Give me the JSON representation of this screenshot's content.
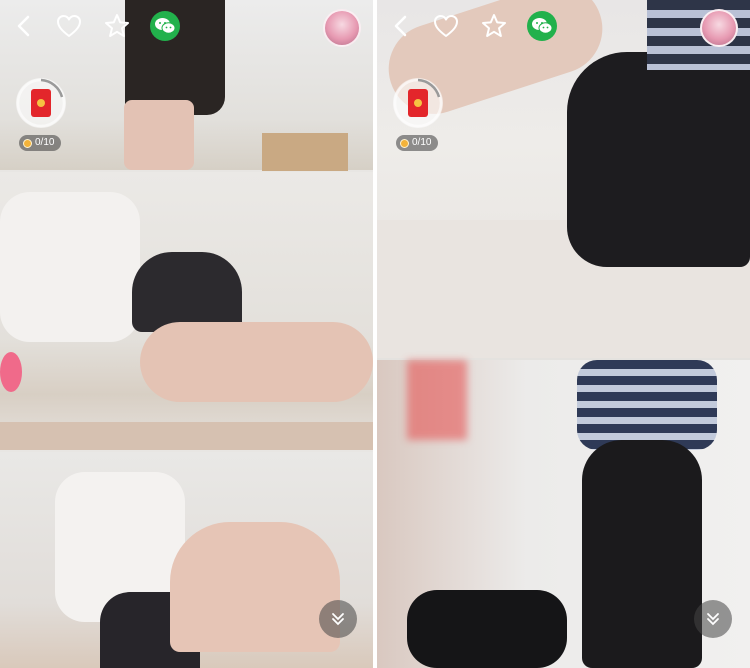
{
  "panels": [
    {
      "id": "left",
      "toolbar": {
        "back_icon": "chevron-left-icon",
        "like_icon": "heart-outline-icon",
        "favorite_icon": "star-outline-icon",
        "share_icon": "wechat-icon",
        "avatar": "user-avatar"
      },
      "red_packet": {
        "icon": "red-packet-icon",
        "count": "0/10"
      },
      "scroll_button_icon": "double-chevron-down-icon"
    },
    {
      "id": "right",
      "toolbar": {
        "back_icon": "chevron-left-icon",
        "like_icon": "heart-outline-icon",
        "favorite_icon": "star-outline-icon",
        "share_icon": "wechat-icon",
        "avatar": "user-avatar"
      },
      "red_packet": {
        "icon": "red-packet-icon",
        "count": "0/10"
      },
      "scroll_button_icon": "double-chevron-down-icon"
    }
  ],
  "colors": {
    "wechat_green": "#22b14c",
    "red_packet": "#e3262b",
    "coin": "#f3b33a",
    "overlay_dark": "#464646"
  }
}
